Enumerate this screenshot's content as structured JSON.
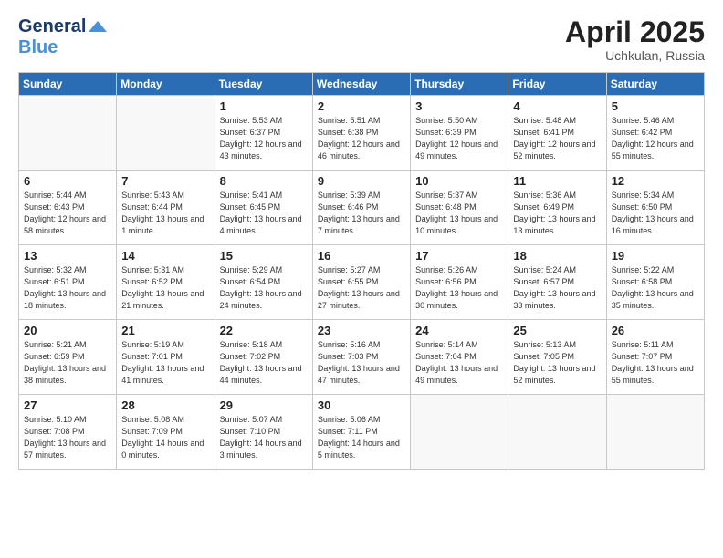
{
  "header": {
    "logo_line1": "General",
    "logo_line2": "Blue",
    "month_year": "April 2025",
    "location": "Uchkulan, Russia"
  },
  "weekdays": [
    "Sunday",
    "Monday",
    "Tuesday",
    "Wednesday",
    "Thursday",
    "Friday",
    "Saturday"
  ],
  "weeks": [
    [
      {
        "day": "",
        "detail": ""
      },
      {
        "day": "",
        "detail": ""
      },
      {
        "day": "1",
        "detail": "Sunrise: 5:53 AM\nSunset: 6:37 PM\nDaylight: 12 hours\nand 43 minutes."
      },
      {
        "day": "2",
        "detail": "Sunrise: 5:51 AM\nSunset: 6:38 PM\nDaylight: 12 hours\nand 46 minutes."
      },
      {
        "day": "3",
        "detail": "Sunrise: 5:50 AM\nSunset: 6:39 PM\nDaylight: 12 hours\nand 49 minutes."
      },
      {
        "day": "4",
        "detail": "Sunrise: 5:48 AM\nSunset: 6:41 PM\nDaylight: 12 hours\nand 52 minutes."
      },
      {
        "day": "5",
        "detail": "Sunrise: 5:46 AM\nSunset: 6:42 PM\nDaylight: 12 hours\nand 55 minutes."
      }
    ],
    [
      {
        "day": "6",
        "detail": "Sunrise: 5:44 AM\nSunset: 6:43 PM\nDaylight: 12 hours\nand 58 minutes."
      },
      {
        "day": "7",
        "detail": "Sunrise: 5:43 AM\nSunset: 6:44 PM\nDaylight: 13 hours\nand 1 minute."
      },
      {
        "day": "8",
        "detail": "Sunrise: 5:41 AM\nSunset: 6:45 PM\nDaylight: 13 hours\nand 4 minutes."
      },
      {
        "day": "9",
        "detail": "Sunrise: 5:39 AM\nSunset: 6:46 PM\nDaylight: 13 hours\nand 7 minutes."
      },
      {
        "day": "10",
        "detail": "Sunrise: 5:37 AM\nSunset: 6:48 PM\nDaylight: 13 hours\nand 10 minutes."
      },
      {
        "day": "11",
        "detail": "Sunrise: 5:36 AM\nSunset: 6:49 PM\nDaylight: 13 hours\nand 13 minutes."
      },
      {
        "day": "12",
        "detail": "Sunrise: 5:34 AM\nSunset: 6:50 PM\nDaylight: 13 hours\nand 16 minutes."
      }
    ],
    [
      {
        "day": "13",
        "detail": "Sunrise: 5:32 AM\nSunset: 6:51 PM\nDaylight: 13 hours\nand 18 minutes."
      },
      {
        "day": "14",
        "detail": "Sunrise: 5:31 AM\nSunset: 6:52 PM\nDaylight: 13 hours\nand 21 minutes."
      },
      {
        "day": "15",
        "detail": "Sunrise: 5:29 AM\nSunset: 6:54 PM\nDaylight: 13 hours\nand 24 minutes."
      },
      {
        "day": "16",
        "detail": "Sunrise: 5:27 AM\nSunset: 6:55 PM\nDaylight: 13 hours\nand 27 minutes."
      },
      {
        "day": "17",
        "detail": "Sunrise: 5:26 AM\nSunset: 6:56 PM\nDaylight: 13 hours\nand 30 minutes."
      },
      {
        "day": "18",
        "detail": "Sunrise: 5:24 AM\nSunset: 6:57 PM\nDaylight: 13 hours\nand 33 minutes."
      },
      {
        "day": "19",
        "detail": "Sunrise: 5:22 AM\nSunset: 6:58 PM\nDaylight: 13 hours\nand 35 minutes."
      }
    ],
    [
      {
        "day": "20",
        "detail": "Sunrise: 5:21 AM\nSunset: 6:59 PM\nDaylight: 13 hours\nand 38 minutes."
      },
      {
        "day": "21",
        "detail": "Sunrise: 5:19 AM\nSunset: 7:01 PM\nDaylight: 13 hours\nand 41 minutes."
      },
      {
        "day": "22",
        "detail": "Sunrise: 5:18 AM\nSunset: 7:02 PM\nDaylight: 13 hours\nand 44 minutes."
      },
      {
        "day": "23",
        "detail": "Sunrise: 5:16 AM\nSunset: 7:03 PM\nDaylight: 13 hours\nand 47 minutes."
      },
      {
        "day": "24",
        "detail": "Sunrise: 5:14 AM\nSunset: 7:04 PM\nDaylight: 13 hours\nand 49 minutes."
      },
      {
        "day": "25",
        "detail": "Sunrise: 5:13 AM\nSunset: 7:05 PM\nDaylight: 13 hours\nand 52 minutes."
      },
      {
        "day": "26",
        "detail": "Sunrise: 5:11 AM\nSunset: 7:07 PM\nDaylight: 13 hours\nand 55 minutes."
      }
    ],
    [
      {
        "day": "27",
        "detail": "Sunrise: 5:10 AM\nSunset: 7:08 PM\nDaylight: 13 hours\nand 57 minutes."
      },
      {
        "day": "28",
        "detail": "Sunrise: 5:08 AM\nSunset: 7:09 PM\nDaylight: 14 hours\nand 0 minutes."
      },
      {
        "day": "29",
        "detail": "Sunrise: 5:07 AM\nSunset: 7:10 PM\nDaylight: 14 hours\nand 3 minutes."
      },
      {
        "day": "30",
        "detail": "Sunrise: 5:06 AM\nSunset: 7:11 PM\nDaylight: 14 hours\nand 5 minutes."
      },
      {
        "day": "",
        "detail": ""
      },
      {
        "day": "",
        "detail": ""
      },
      {
        "day": "",
        "detail": ""
      }
    ]
  ]
}
